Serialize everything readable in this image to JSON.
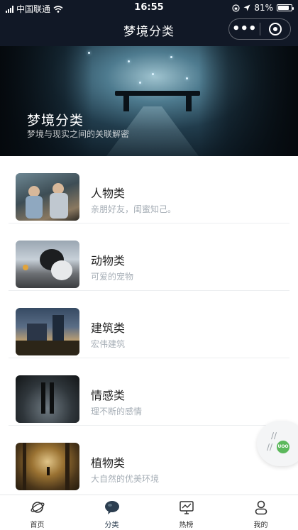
{
  "status_bar": {
    "carrier": "中国联通",
    "time": "16:55",
    "battery": "81%",
    "battery_level": 0.81
  },
  "nav": {
    "title": "梦境分类",
    "more_label": "•••"
  },
  "banner": {
    "title": "梦境分类",
    "subtitle": "梦境与现实之间的关联解密"
  },
  "categories": [
    {
      "title": "人物类",
      "desc": "亲朋好友，闺蜜知己。"
    },
    {
      "title": "动物类",
      "desc": "可爱的宠物"
    },
    {
      "title": "建筑类",
      "desc": "宏伟建筑"
    },
    {
      "title": "情感类",
      "desc": "理不断的感情"
    },
    {
      "title": "植物类",
      "desc": "大自然的优美环境"
    }
  ],
  "floating": {
    "badge_text": "UOO"
  },
  "tabs": [
    {
      "label": "首页",
      "icon": "planet-icon"
    },
    {
      "label": "分类",
      "icon": "chat-bubble-icon"
    },
    {
      "label": "热榜",
      "icon": "monitor-chart-icon"
    },
    {
      "label": "我的",
      "icon": "user-icon"
    }
  ],
  "colors": {
    "header_bg": "#111826",
    "active_tab": "#2c3e50",
    "desc_text": "#a6aeb6"
  }
}
